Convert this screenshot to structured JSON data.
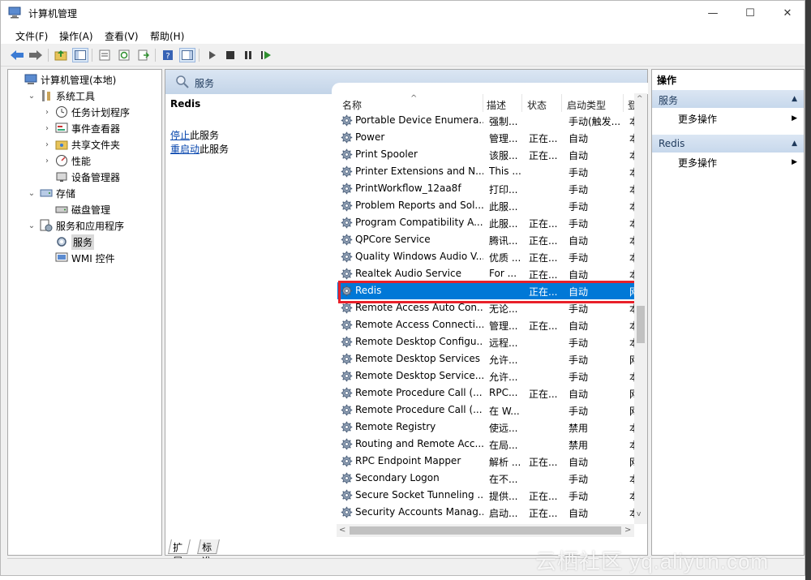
{
  "window": {
    "title": "计算机管理"
  },
  "menubar": [
    "文件(F)",
    "操作(A)",
    "查看(V)",
    "帮助(H)"
  ],
  "tree": {
    "items": [
      {
        "label": "计算机管理(本地)",
        "level": 0,
        "expander": "",
        "icon": "computer-icon"
      },
      {
        "label": "系统工具",
        "level": 1,
        "expander": "v",
        "icon": "tools-icon"
      },
      {
        "label": "任务计划程序",
        "level": 2,
        "expander": ">",
        "icon": "clock-icon"
      },
      {
        "label": "事件查看器",
        "level": 2,
        "expander": ">",
        "icon": "event-viewer-icon"
      },
      {
        "label": "共享文件夹",
        "level": 2,
        "expander": ">",
        "icon": "shared-folder-icon"
      },
      {
        "label": "性能",
        "level": 2,
        "expander": ">",
        "icon": "performance-icon"
      },
      {
        "label": "设备管理器",
        "level": 2,
        "expander": "",
        "icon": "device-manager-icon"
      },
      {
        "label": "存储",
        "level": 1,
        "expander": "v",
        "icon": "storage-icon"
      },
      {
        "label": "磁盘管理",
        "level": 2,
        "expander": "",
        "icon": "disk-icon"
      },
      {
        "label": "服务和应用程序",
        "level": 1,
        "expander": "v",
        "icon": "services-apps-icon"
      },
      {
        "label": "服务",
        "level": 2,
        "expander": "",
        "icon": "services-icon",
        "selected": true
      },
      {
        "label": "WMI 控件",
        "level": 2,
        "expander": "",
        "icon": "wmi-icon"
      }
    ]
  },
  "main": {
    "header": "服务",
    "detail": {
      "title": "Redis",
      "stop_link": "停止",
      "stop_suffix": "此服务",
      "restart_link": "重启动",
      "restart_suffix": "此服务"
    },
    "columns": [
      "名称",
      "描述",
      "状态",
      "启动类型",
      "登"
    ],
    "sort_indicator": "^",
    "rows": [
      {
        "name": "Portable Device Enumera...",
        "desc": "强制...",
        "status": "",
        "startup": "手动(触发...",
        "logon": "本"
      },
      {
        "name": "Power",
        "desc": "管理...",
        "status": "正在...",
        "startup": "自动",
        "logon": "本"
      },
      {
        "name": "Print Spooler",
        "desc": "该服...",
        "status": "正在...",
        "startup": "自动",
        "logon": "本"
      },
      {
        "name": "Printer Extensions and N...",
        "desc": "This ...",
        "status": "",
        "startup": "手动",
        "logon": "本"
      },
      {
        "name": "PrintWorkflow_12aa8f",
        "desc": "打印...",
        "status": "",
        "startup": "手动",
        "logon": "本"
      },
      {
        "name": "Problem Reports and Sol...",
        "desc": "此服...",
        "status": "",
        "startup": "手动",
        "logon": "本"
      },
      {
        "name": "Program Compatibility A...",
        "desc": "此服...",
        "status": "正在...",
        "startup": "手动",
        "logon": "本"
      },
      {
        "name": "QPCore Service",
        "desc": "腾讯...",
        "status": "正在...",
        "startup": "自动",
        "logon": "本"
      },
      {
        "name": "Quality Windows Audio V...",
        "desc": "优质 ...",
        "status": "正在...",
        "startup": "手动",
        "logon": "本"
      },
      {
        "name": "Realtek Audio Service",
        "desc": "For ...",
        "status": "正在...",
        "startup": "自动",
        "logon": "本"
      },
      {
        "name": "Redis",
        "desc": "",
        "status": "正在...",
        "startup": "自动",
        "logon": "网",
        "selected": true
      },
      {
        "name": "Remote Access Auto Con...",
        "desc": "无论...",
        "status": "",
        "startup": "手动",
        "logon": "本"
      },
      {
        "name": "Remote Access Connecti...",
        "desc": "管理...",
        "status": "正在...",
        "startup": "自动",
        "logon": "本"
      },
      {
        "name": "Remote Desktop Configu...",
        "desc": "远程...",
        "status": "",
        "startup": "手动",
        "logon": "本"
      },
      {
        "name": "Remote Desktop Services",
        "desc": "允许...",
        "status": "",
        "startup": "手动",
        "logon": "网"
      },
      {
        "name": "Remote Desktop Service...",
        "desc": "允许...",
        "status": "",
        "startup": "手动",
        "logon": "本"
      },
      {
        "name": "Remote Procedure Call (...",
        "desc": "RPC...",
        "status": "正在...",
        "startup": "自动",
        "logon": "网"
      },
      {
        "name": "Remote Procedure Call (...",
        "desc": "在 W...",
        "status": "",
        "startup": "手动",
        "logon": "网"
      },
      {
        "name": "Remote Registry",
        "desc": "使远...",
        "status": "",
        "startup": "禁用",
        "logon": "本"
      },
      {
        "name": "Routing and Remote Acc...",
        "desc": "在局...",
        "status": "",
        "startup": "禁用",
        "logon": "本"
      },
      {
        "name": "RPC Endpoint Mapper",
        "desc": "解析 ...",
        "status": "正在...",
        "startup": "自动",
        "logon": "网"
      },
      {
        "name": "Secondary Logon",
        "desc": "在不...",
        "status": "",
        "startup": "手动",
        "logon": "本"
      },
      {
        "name": "Secure Socket Tunneling ...",
        "desc": "提供...",
        "status": "正在...",
        "startup": "手动",
        "logon": "本"
      },
      {
        "name": "Security Accounts Manag...",
        "desc": "启动...",
        "status": "正在...",
        "startup": "自动",
        "logon": "本"
      }
    ],
    "tabs": [
      "扩展",
      "标准"
    ]
  },
  "actions": {
    "title": "操作",
    "sections": [
      {
        "label": "服务",
        "item": "更多操作"
      },
      {
        "label": "Redis",
        "item": "更多操作"
      }
    ]
  },
  "watermark": "云栖社区 yq.aliyun.com",
  "colors": {
    "selection": "#0078d7",
    "highlight_box": "#e8202a",
    "link": "#0645ad"
  }
}
